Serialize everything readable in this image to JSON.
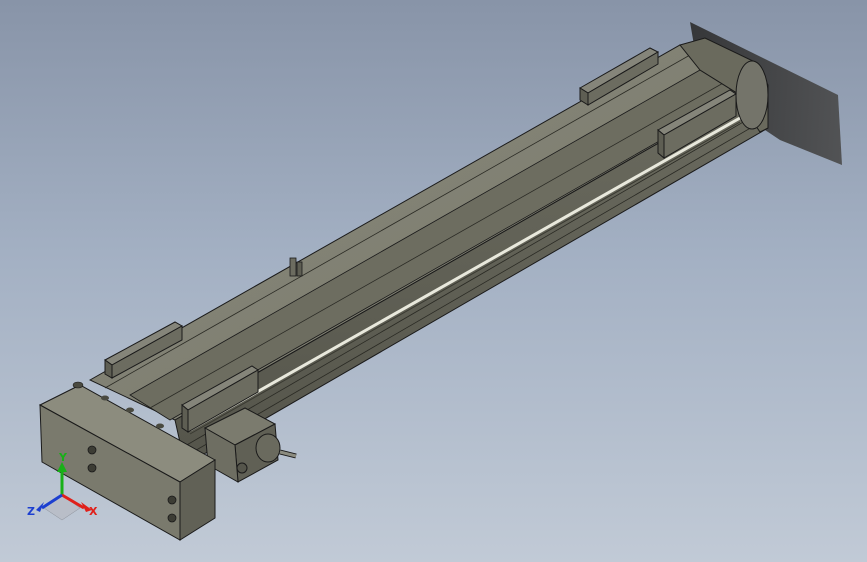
{
  "viewport": {
    "background_top": "#8894a8",
    "background_bottom": "#c1cad6"
  },
  "model": {
    "kind": "linear-actuator-module",
    "body_color": "#7d7d6e",
    "edge_color": "#1a1a1a",
    "rail_color": "#e8e8dc"
  },
  "triad": {
    "x_label": "X",
    "y_label": "Y",
    "z_label": "Z",
    "x_color": "#e0201a",
    "y_color": "#18b018",
    "z_color": "#1c3fd0"
  }
}
